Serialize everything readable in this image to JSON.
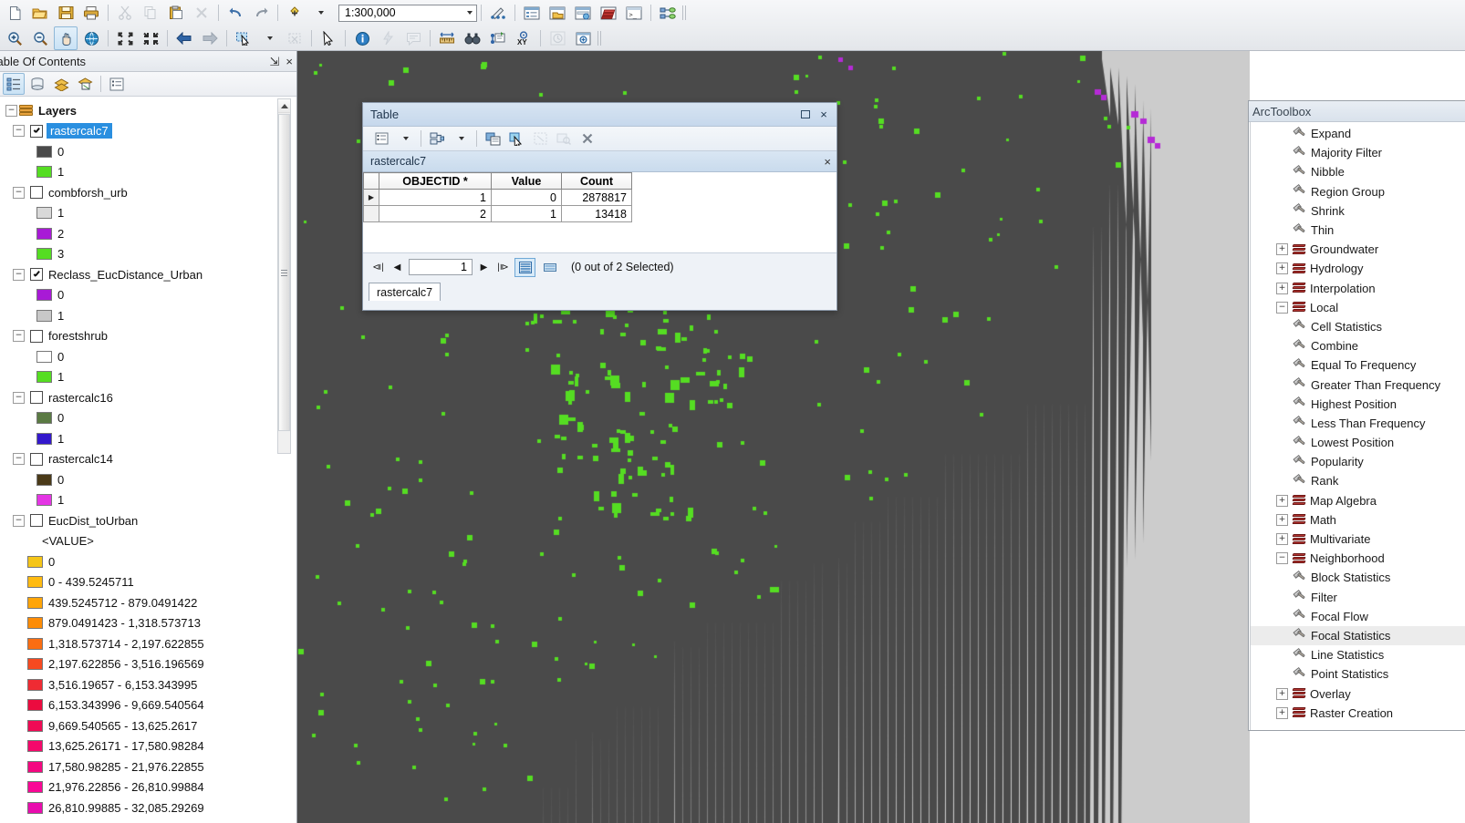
{
  "app": {
    "scale": "1:300,000"
  },
  "toolbar": {
    "row1": [
      {
        "name": "new-map-icon",
        "glyph": "page"
      },
      {
        "name": "open-map-icon",
        "glyph": "folder"
      },
      {
        "name": "save-map-icon",
        "glyph": "save"
      },
      {
        "name": "print-map-icon",
        "glyph": "print"
      },
      {
        "name": "cut-icon",
        "glyph": "cut"
      },
      {
        "name": "copy-icon",
        "glyph": "copy"
      },
      {
        "name": "paste-icon",
        "glyph": "paste"
      },
      {
        "name": "delete-icon",
        "glyph": "delete"
      },
      {
        "name": "undo-icon",
        "glyph": "undo"
      },
      {
        "name": "redo-icon",
        "glyph": "redo"
      },
      {
        "name": "add-data-icon",
        "glyph": "adddata"
      }
    ],
    "row1b": [
      {
        "name": "editor-toolbar-icon",
        "glyph": "editor"
      },
      {
        "name": "table-of-contents-window-icon",
        "glyph": "win-toc"
      },
      {
        "name": "catalog-window-icon",
        "glyph": "win-catalog"
      },
      {
        "name": "search-window-icon",
        "glyph": "win-search"
      },
      {
        "name": "arctoolbox-window-icon",
        "glyph": "win-toolbox"
      },
      {
        "name": "python-window-icon",
        "glyph": "win-python"
      },
      {
        "name": "modelbuilder-icon",
        "glyph": "model"
      }
    ],
    "row2": [
      {
        "name": "zoom-in-icon",
        "glyph": "zoomin",
        "active": false
      },
      {
        "name": "zoom-out-icon",
        "glyph": "zoomout",
        "active": false
      },
      {
        "name": "pan-icon",
        "glyph": "pan",
        "active": true
      },
      {
        "name": "full-extent-icon",
        "glyph": "globe",
        "active": false
      },
      {
        "name": "fixed-zoom-in-icon",
        "glyph": "fzin",
        "active": false
      },
      {
        "name": "fixed-zoom-out-icon",
        "glyph": "fzout",
        "active": false
      },
      {
        "name": "go-back-extent-icon",
        "glyph": "back",
        "active": false
      },
      {
        "name": "go-forward-extent-icon",
        "glyph": "forward",
        "active": false
      },
      {
        "name": "select-features-icon",
        "glyph": "selectfeat",
        "active": false
      },
      {
        "name": "clear-selection-icon",
        "glyph": "clearsel",
        "active": false
      },
      {
        "name": "select-elements-icon",
        "glyph": "arrow",
        "active": false
      },
      {
        "name": "identify-icon",
        "glyph": "identify",
        "active": false
      },
      {
        "name": "hyperlink-icon",
        "glyph": "bolt",
        "active": false
      },
      {
        "name": "html-popup-icon",
        "glyph": "popup",
        "active": false
      },
      {
        "name": "measure-icon",
        "glyph": "measure",
        "active": false
      },
      {
        "name": "find-icon",
        "glyph": "binoc",
        "active": false
      },
      {
        "name": "find-route-icon",
        "glyph": "route",
        "active": false
      },
      {
        "name": "go-to-xy-icon",
        "glyph": "xy",
        "active": false
      },
      {
        "name": "time-slider-icon",
        "glyph": "clock",
        "active": false
      },
      {
        "name": "create-viewer-window-icon",
        "glyph": "viewer",
        "active": false
      }
    ]
  },
  "toc": {
    "title": "Table Of Contents",
    "pin": "⇲",
    "close": "×",
    "tools": [
      {
        "name": "list-by-drawing-order-icon"
      },
      {
        "name": "list-by-source-icon"
      },
      {
        "name": "list-by-visibility-icon"
      },
      {
        "name": "list-by-selection-icon"
      },
      {
        "name": "options-icon"
      }
    ],
    "root": {
      "label": "Layers",
      "expander": "−"
    },
    "layers": [
      {
        "name": "rastercalc7",
        "checked": true,
        "selected": true,
        "expander": "−",
        "symbols": [
          {
            "label": "0",
            "color": "#4a4a4a"
          },
          {
            "label": "1",
            "color": "#55dd22"
          }
        ]
      },
      {
        "name": "combforsh_urb",
        "checked": false,
        "selected": false,
        "expander": "−",
        "symbols": [
          {
            "label": "1",
            "color": "#d9d9d9"
          },
          {
            "label": "2",
            "color": "#a81ad6"
          },
          {
            "label": "3",
            "color": "#55dd22"
          }
        ]
      },
      {
        "name": "Reclass_EucDistance_Urban",
        "checked": true,
        "selected": false,
        "expander": "−",
        "symbols": [
          {
            "label": "0",
            "color": "#a81ad6"
          },
          {
            "label": "1",
            "color": "#c8c8c8"
          }
        ]
      },
      {
        "name": "forestshrub",
        "checked": false,
        "selected": false,
        "expander": "−",
        "symbols": [
          {
            "label": "0",
            "color": "#ffffff"
          },
          {
            "label": "1",
            "color": "#55dd22"
          }
        ]
      },
      {
        "name": "rastercalc16",
        "checked": false,
        "selected": false,
        "expander": "−",
        "symbols": [
          {
            "label": "0",
            "color": "#5a7a43"
          },
          {
            "label": "1",
            "color": "#3318cc"
          }
        ]
      },
      {
        "name": "rastercalc14",
        "checked": false,
        "selected": false,
        "expander": "−",
        "symbols": [
          {
            "label": "0",
            "color": "#4a3a18"
          },
          {
            "label": "1",
            "color": "#e435e4"
          }
        ]
      }
    ],
    "eucdist": {
      "name": "EucDist_toUrban",
      "checked": false,
      "expander": "−",
      "value_header": "<VALUE>",
      "classes": [
        {
          "label": "0",
          "color": "#f5c518"
        },
        {
          "label": "0 - 439.5245711",
          "color": "#ffbb11"
        },
        {
          "label": "439.5245712 - 879.0491422",
          "color": "#ffa508"
        },
        {
          "label": "879.0491423 - 1,318.573713",
          "color": "#fd8c06"
        },
        {
          "label": "1,318.573714 - 2,197.622855",
          "color": "#fa6d12"
        },
        {
          "label": "2,197.622856 - 3,516.196569",
          "color": "#f74a20"
        },
        {
          "label": "3,516.19657 - 6,153.343995",
          "color": "#ef2b33"
        },
        {
          "label": "6,153.343996 - 9,669.540564",
          "color": "#ec0b3f"
        },
        {
          "label": "9,669.540565 - 13,625.2617",
          "color": "#f00a55"
        },
        {
          "label": "13,625.26171 - 17,580.98284",
          "color": "#f5086b"
        },
        {
          "label": "17,580.98285 - 21,976.22855",
          "color": "#f40781"
        },
        {
          "label": "21,976.22856 - 26,810.99884",
          "color": "#f90696"
        },
        {
          "label": "26,810.99885 - 32,085.29269",
          "color": "#e90cae"
        }
      ]
    }
  },
  "table_window": {
    "title": "Table",
    "maximize": "□",
    "close": "×",
    "tools": [
      {
        "name": "table-options-icon"
      },
      {
        "name": "related-tables-icon"
      },
      {
        "name": "move-field-icon"
      },
      {
        "name": "select-by-attributes-icon"
      },
      {
        "name": "switch-selection-icon"
      },
      {
        "name": "zoom-to-selected-icon"
      },
      {
        "name": "clear-selection-icon"
      }
    ],
    "tab_label": "rastercalc7",
    "tab_close": "×",
    "columns": [
      "OBJECTID *",
      "Value",
      "Count"
    ],
    "rows": [
      {
        "marker": "▶",
        "OBJECTID": "1",
        "Value": "0",
        "Count": "2878817"
      },
      {
        "marker": "",
        "OBJECTID": "2",
        "Value": "1",
        "Count": "13418"
      }
    ],
    "nav": {
      "first": "⧏|",
      "prev": "◀",
      "page": "1",
      "next": "▶",
      "last": "|⧐",
      "view_table_icon": "table-view-icon",
      "view_selected_icon": "selected-view-icon",
      "status": "(0 out of 2 Selected)"
    },
    "bottom_tab": "rastercalc7"
  },
  "arctoolbox": {
    "title": "ArcToolbox",
    "items": [
      {
        "label": "Expand",
        "type": "tool",
        "indent": 3,
        "expander": null,
        "highlight": false
      },
      {
        "label": "Majority Filter",
        "type": "tool",
        "indent": 3,
        "expander": null,
        "highlight": false
      },
      {
        "label": "Nibble",
        "type": "tool",
        "indent": 3,
        "expander": null,
        "highlight": false
      },
      {
        "label": "Region Group",
        "type": "tool",
        "indent": 3,
        "expander": null,
        "highlight": false
      },
      {
        "label": "Shrink",
        "type": "tool",
        "indent": 3,
        "expander": null,
        "highlight": false
      },
      {
        "label": "Thin",
        "type": "tool",
        "indent": 3,
        "expander": null,
        "highlight": false
      },
      {
        "label": "Groundwater",
        "type": "toolbox",
        "indent": 2,
        "expander": "+",
        "highlight": false
      },
      {
        "label": "Hydrology",
        "type": "toolbox",
        "indent": 2,
        "expander": "+",
        "highlight": false
      },
      {
        "label": "Interpolation",
        "type": "toolbox",
        "indent": 2,
        "expander": "+",
        "highlight": false
      },
      {
        "label": "Local",
        "type": "toolbox",
        "indent": 2,
        "expander": "−",
        "highlight": false
      },
      {
        "label": "Cell Statistics",
        "type": "tool",
        "indent": 3,
        "expander": null,
        "highlight": false
      },
      {
        "label": "Combine",
        "type": "tool",
        "indent": 3,
        "expander": null,
        "highlight": false
      },
      {
        "label": "Equal To Frequency",
        "type": "tool",
        "indent": 3,
        "expander": null,
        "highlight": false
      },
      {
        "label": "Greater Than Frequency",
        "type": "tool",
        "indent": 3,
        "expander": null,
        "highlight": false
      },
      {
        "label": "Highest Position",
        "type": "tool",
        "indent": 3,
        "expander": null,
        "highlight": false
      },
      {
        "label": "Less Than Frequency",
        "type": "tool",
        "indent": 3,
        "expander": null,
        "highlight": false
      },
      {
        "label": "Lowest Position",
        "type": "tool",
        "indent": 3,
        "expander": null,
        "highlight": false
      },
      {
        "label": "Popularity",
        "type": "tool",
        "indent": 3,
        "expander": null,
        "highlight": false
      },
      {
        "label": "Rank",
        "type": "tool",
        "indent": 3,
        "expander": null,
        "highlight": false
      },
      {
        "label": "Map Algebra",
        "type": "toolbox",
        "indent": 2,
        "expander": "+",
        "highlight": false
      },
      {
        "label": "Math",
        "type": "toolbox",
        "indent": 2,
        "expander": "+",
        "highlight": false
      },
      {
        "label": "Multivariate",
        "type": "toolbox",
        "indent": 2,
        "expander": "+",
        "highlight": false
      },
      {
        "label": "Neighborhood",
        "type": "toolbox",
        "indent": 2,
        "expander": "−",
        "highlight": false
      },
      {
        "label": "Block Statistics",
        "type": "tool",
        "indent": 3,
        "expander": null,
        "highlight": false
      },
      {
        "label": "Filter",
        "type": "tool",
        "indent": 3,
        "expander": null,
        "highlight": false
      },
      {
        "label": "Focal Flow",
        "type": "tool",
        "indent": 3,
        "expander": null,
        "highlight": false
      },
      {
        "label": "Focal Statistics",
        "type": "tool",
        "indent": 3,
        "expander": null,
        "highlight": true
      },
      {
        "label": "Line Statistics",
        "type": "tool",
        "indent": 3,
        "expander": null,
        "highlight": false
      },
      {
        "label": "Point Statistics",
        "type": "tool",
        "indent": 3,
        "expander": null,
        "highlight": false
      },
      {
        "label": "Overlay",
        "type": "toolbox",
        "indent": 2,
        "expander": "+",
        "highlight": false
      },
      {
        "label": "Raster Creation",
        "type": "toolbox",
        "indent": 2,
        "expander": "+",
        "highlight": false
      }
    ]
  },
  "map": {
    "raster_nodata_color": "#cccccc",
    "raster_zero_color": "#4a4a4a",
    "raster_one_color": "#55dd22",
    "urban_edge_color": "#b52ad6"
  }
}
